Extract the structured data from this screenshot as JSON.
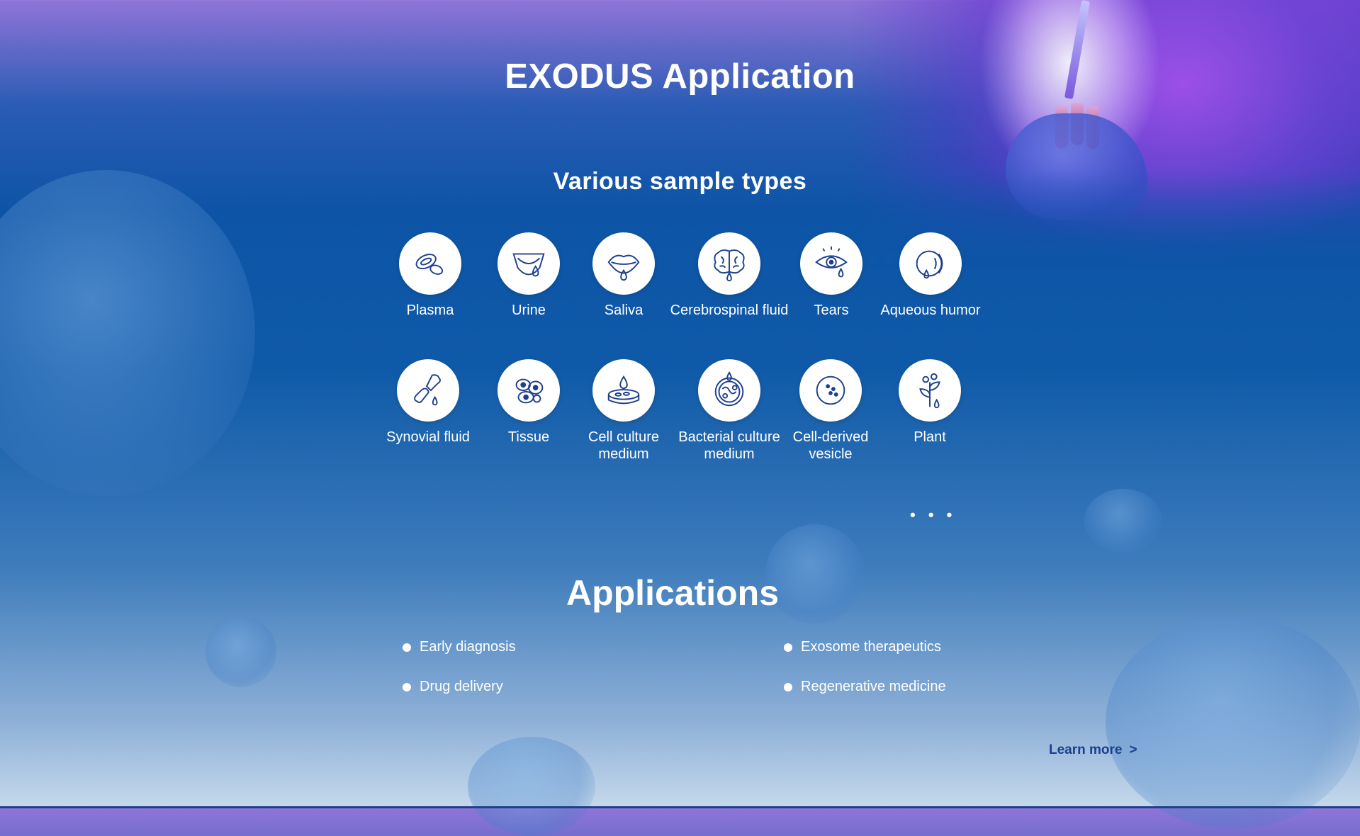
{
  "header": {
    "title": "EXODUS Application"
  },
  "samples": {
    "title": "Various sample types",
    "items": [
      {
        "label": "Plasma",
        "icon": "plasma-cells-icon"
      },
      {
        "label": "Urine",
        "icon": "urine-diaper-icon"
      },
      {
        "label": "Saliva",
        "icon": "saliva-mouth-icon"
      },
      {
        "label": "Cerebrospinal fluid",
        "icon": "brain-icon"
      },
      {
        "label": "Tears",
        "icon": "eye-tears-icon"
      },
      {
        "label": "Aqueous humor",
        "icon": "eyeball-icon"
      },
      {
        "label": "Synovial fluid",
        "icon": "joint-icon"
      },
      {
        "label": "Tissue",
        "icon": "tissue-cells-icon"
      },
      {
        "label": "Cell culture medium",
        "icon": "petri-dish-icon"
      },
      {
        "label": "Bacterial culture medium",
        "icon": "bacteria-icon"
      },
      {
        "label": "Cell-derived vesicle",
        "icon": "vesicle-icon"
      },
      {
        "label": "Plant",
        "icon": "plant-icon"
      }
    ],
    "more": "• • •"
  },
  "applications": {
    "title": "Applications",
    "items": [
      "Early diagnosis",
      "Exosome therapeutics",
      "Drug delivery",
      "Regenerative medicine"
    ]
  },
  "learn_more": {
    "label": "Learn more",
    "chevron": ">"
  },
  "colors": {
    "accent": "#0d54a6",
    "link": "#1a3f8f",
    "white": "#ffffff"
  }
}
